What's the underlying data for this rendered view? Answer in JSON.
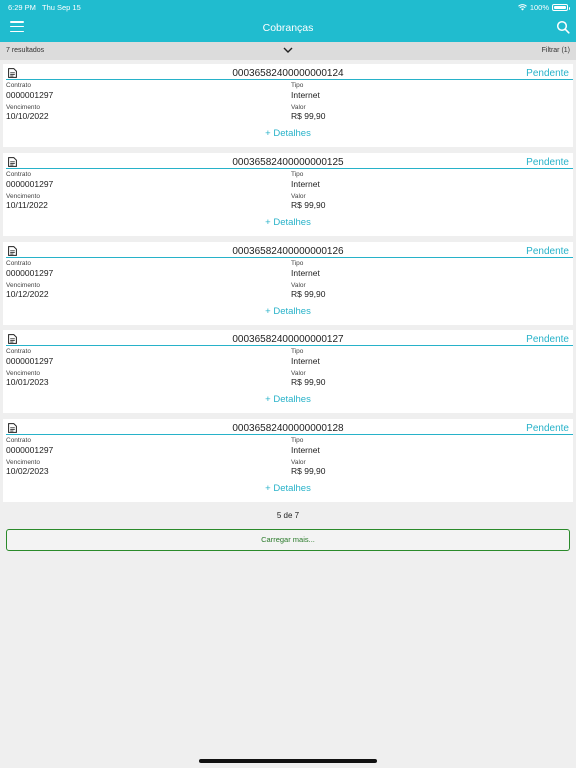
{
  "status_bar": {
    "time": "6:29 PM",
    "date": "Thu Sep 15",
    "battery": "100%",
    "battery_level": 1.0
  },
  "header": {
    "title": "Cobranças",
    "menu_icon": "hamburger-icon",
    "search_icon": "search-icon"
  },
  "filter_bar": {
    "results": "7 resultados",
    "filter_label": "Filtrar (1)",
    "toggle_icon": "chevron-down-icon"
  },
  "labels": {
    "contract": "Contrato",
    "type": "Tipo",
    "due": "Vencimento",
    "value": "Valor",
    "details": "+ Detalhes"
  },
  "items": [
    {
      "number": "00036582400000000124",
      "status": "Pendente",
      "contract": "0000001297",
      "type": "Internet",
      "due": "10/10/2022",
      "value": "R$ 99,90"
    },
    {
      "number": "00036582400000000125",
      "status": "Pendente",
      "contract": "0000001297",
      "type": "Internet",
      "due": "10/11/2022",
      "value": "R$ 99,90"
    },
    {
      "number": "00036582400000000126",
      "status": "Pendente",
      "contract": "0000001297",
      "type": "Internet",
      "due": "10/12/2022",
      "value": "R$ 99,90"
    },
    {
      "number": "00036582400000000127",
      "status": "Pendente",
      "contract": "0000001297",
      "type": "Internet",
      "due": "10/01/2023",
      "value": "R$ 99,90"
    },
    {
      "number": "00036582400000000128",
      "status": "Pendente",
      "contract": "0000001297",
      "type": "Internet",
      "due": "10/02/2023",
      "value": "R$ 99,90"
    }
  ],
  "pager": {
    "text": "5 de 7"
  },
  "load_more": {
    "label": "Carregar mais..."
  },
  "colors": {
    "brand": "#20bccf",
    "accent": "#27b2c9",
    "load_more_border": "#2a8a2a",
    "background": "#efefef"
  }
}
